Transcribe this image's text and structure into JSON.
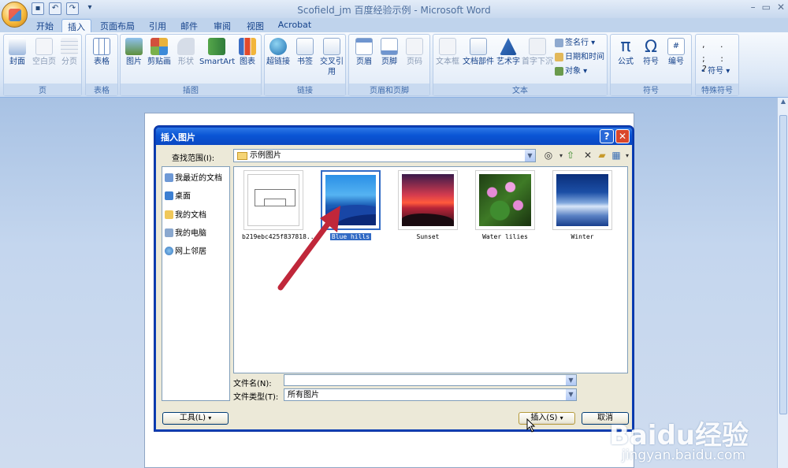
{
  "window": {
    "title": "Scofield_jm 百度经验示例 - Microsoft Word"
  },
  "tabs": [
    "开始",
    "插入",
    "页面布局",
    "引用",
    "邮件",
    "审阅",
    "视图",
    "Acrobat"
  ],
  "active_tab": "插入",
  "ribbon": {
    "pages": {
      "label": "页",
      "buttons": [
        "封面",
        "空白页",
        "分页"
      ]
    },
    "table": {
      "label": "表格",
      "buttons": [
        "表格"
      ]
    },
    "illus": {
      "label": "插图",
      "buttons": [
        "图片",
        "剪贴画",
        "形状",
        "SmartArt",
        "图表"
      ]
    },
    "links": {
      "label": "链接",
      "buttons": [
        "超链接",
        "书签",
        "交叉引用"
      ]
    },
    "hf": {
      "label": "页眉和页脚",
      "buttons": [
        "页眉",
        "页脚",
        "页码"
      ]
    },
    "text": {
      "label": "文本",
      "buttons": [
        "文本框",
        "文档部件",
        "艺术字",
        "首字下沉"
      ],
      "small": [
        "签名行",
        "日期和时间",
        "对象"
      ]
    },
    "symbols": {
      "label": "符号",
      "buttons": [
        "公式",
        "符号",
        "编号"
      ]
    },
    "special": {
      "label": "特殊符号",
      "button": "符号"
    }
  },
  "dialog": {
    "title": "插入图片",
    "look_in_label": "查找范围(I):",
    "look_in_value": "示例图片",
    "places": [
      "我最近的文档",
      "桌面",
      "我的文档",
      "我的电脑",
      "网上邻居"
    ],
    "files": [
      {
        "name": "b219ebc425f837818...",
        "selected": false
      },
      {
        "name": "Blue hills",
        "selected": true
      },
      {
        "name": "Sunset",
        "selected": false
      },
      {
        "name": "Water lilies",
        "selected": false
      },
      {
        "name": "Winter",
        "selected": false
      }
    ],
    "filename_label": "文件名(N):",
    "filename_value": "",
    "filetype_label": "文件类型(T):",
    "filetype_value": "所有图片",
    "tools_button": "工具(L)",
    "insert_button": "插入(S)",
    "cancel_button": "取消"
  },
  "watermark": {
    "brand": "Baidu经验",
    "url": "jingyan.baidu.com"
  }
}
